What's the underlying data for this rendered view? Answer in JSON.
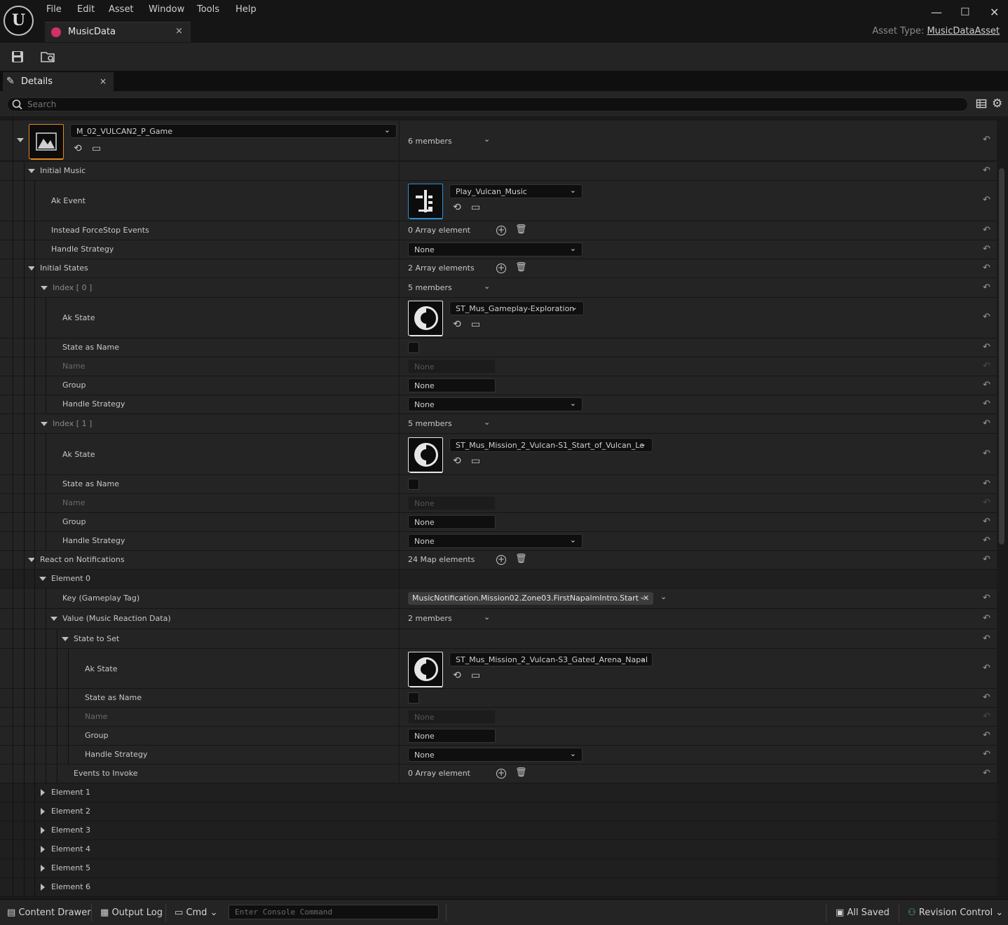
{
  "menu": {
    "file": "File",
    "edit": "Edit",
    "asset": "Asset",
    "window": "Window",
    "tools": "Tools",
    "help": "Help"
  },
  "doc_tab": {
    "label": "MusicData",
    "close": "×"
  },
  "asset_type": {
    "label": "Asset Type:",
    "value": "MusicDataAsset"
  },
  "panel": {
    "title": "Details",
    "close": "×"
  },
  "search": {
    "placeholder": "Search"
  },
  "top_entry": {
    "combo": "M_02_VULCAN2_P_Game",
    "members": "6 members"
  },
  "initial_music": {
    "header": "Initial Music",
    "ak_event_label": "Ak Event",
    "ak_event_value": "Play_Vulcan_Music",
    "force_stop_label": "Instead ForceStop Events",
    "force_stop_value": "0 Array element",
    "handle_label": "Handle Strategy",
    "handle_value": "None"
  },
  "initial_states": {
    "header": "Initial States",
    "count": "2 Array elements",
    "items": [
      {
        "index": "Index [ 0 ]",
        "members": "5 members",
        "ak_state_label": "Ak State",
        "ak_state": "ST_Mus_Gameplay-Exploration",
        "state_as_name": "State as Name",
        "name_label": "Name",
        "name_value": "None",
        "group_label": "Group",
        "group_value": "None",
        "handle_label": "Handle Strategy",
        "handle_value": "None"
      },
      {
        "index": "Index [ 1 ]",
        "members": "5 members",
        "ak_state_label": "Ak State",
        "ak_state": "ST_Mus_Mission_2_Vulcan-S1_Start_of_Vulcan_Le",
        "state_as_name": "State as Name",
        "name_label": "Name",
        "name_value": "None",
        "group_label": "Group",
        "group_value": "None",
        "handle_label": "Handle Strategy",
        "handle_value": "None"
      }
    ]
  },
  "notifications": {
    "header": "React on Notifications",
    "count": "24 Map elements",
    "element0": {
      "label": "Element 0",
      "key_label": "Key (Gameplay Tag)",
      "key_value": "MusicNotification.Mission02.Zone03.FirstNapalmIntro.Start",
      "value_label": "Value (Music Reaction Data)",
      "value_members": "2 members",
      "state_to_set": "State to Set",
      "ak_state_label": "Ak State",
      "ak_state": "ST_Mus_Mission_2_Vulcan-S3_Gated_Arena_Napal",
      "state_as_name": "State as Name",
      "name_label": "Name",
      "name_value": "None",
      "group_label": "Group",
      "group_value": "None",
      "handle_label": "Handle Strategy",
      "handle_value": "None",
      "events_label": "Events to Invoke",
      "events_value": "0 Array element"
    },
    "collapsed": [
      "Element 1",
      "Element 2",
      "Element 3",
      "Element 4",
      "Element 5",
      "Element 6"
    ]
  },
  "bottom": {
    "content_drawer": "Content Drawer",
    "output_log": "Output Log",
    "cmd": "Cmd",
    "console_placeholder": "Enter Console Command",
    "all_saved": "All Saved",
    "revision": "Revision Control"
  },
  "colors": {
    "accent_orange": "#e08a1e",
    "accent_blue": "#2a8fd6",
    "tab_icon": "#d2306a"
  }
}
